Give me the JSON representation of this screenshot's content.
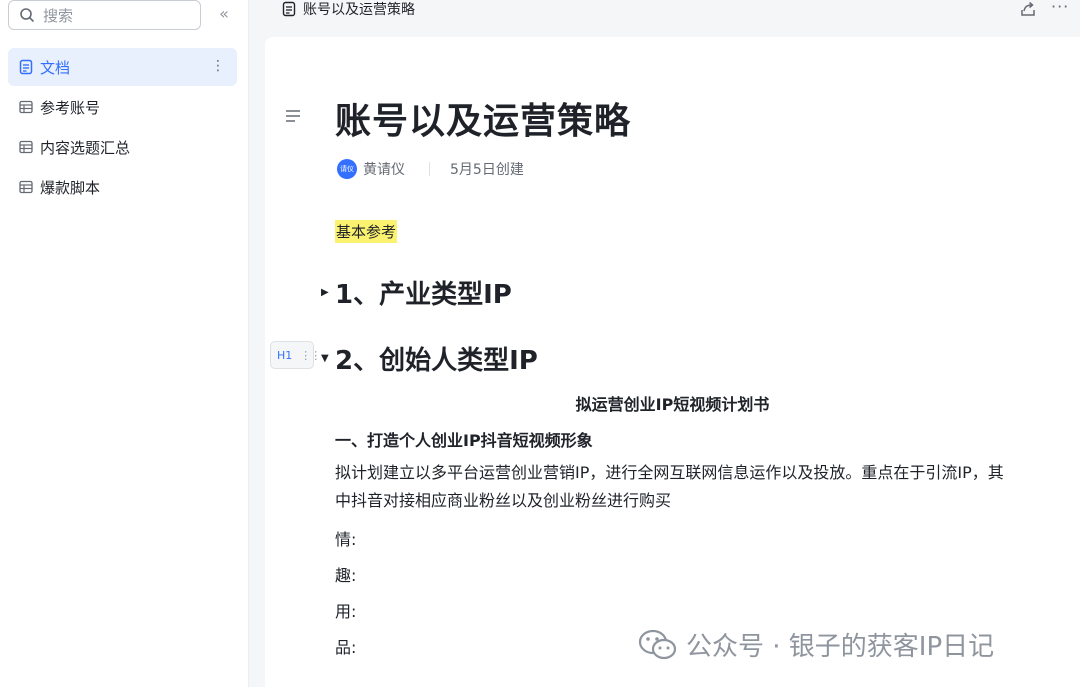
{
  "sidebar": {
    "search_placeholder": "搜索",
    "collapse_icon": "double-chevron-left-icon",
    "items": [
      {
        "label": "文档",
        "active": true
      },
      {
        "label": "参考账号"
      },
      {
        "label": "内容选题汇总"
      },
      {
        "label": "爆款脚本"
      }
    ]
  },
  "topbar": {
    "doc_title": "账号以及运营策略"
  },
  "doc": {
    "title": "账号以及运营策略",
    "author_avatar": "请仪",
    "author": "黄请仪",
    "created": "5月5日创建",
    "highlight": "基本参考",
    "h1_1": "1、产业类型IP",
    "h1_2": "2、创始人类型IP",
    "heading_badge": "H1",
    "center_title": "拟运营创业IP短视频计划书",
    "h3": "一、打造个人创业IP抖音短视频形象",
    "para": "拟计划建立以多平台运营创业营销IP，进行全网互联网信息运作以及投放。重点在于引流IP，其中抖音对接相应商业粉丝以及创业粉丝进行购买",
    "lines": [
      "情:",
      "趣:",
      "用:",
      "品:"
    ]
  },
  "watermark": "公众号 · 银子的获客IP日记",
  "colors": {
    "accent": "#3370ff",
    "highlight": "#fbf36f"
  }
}
